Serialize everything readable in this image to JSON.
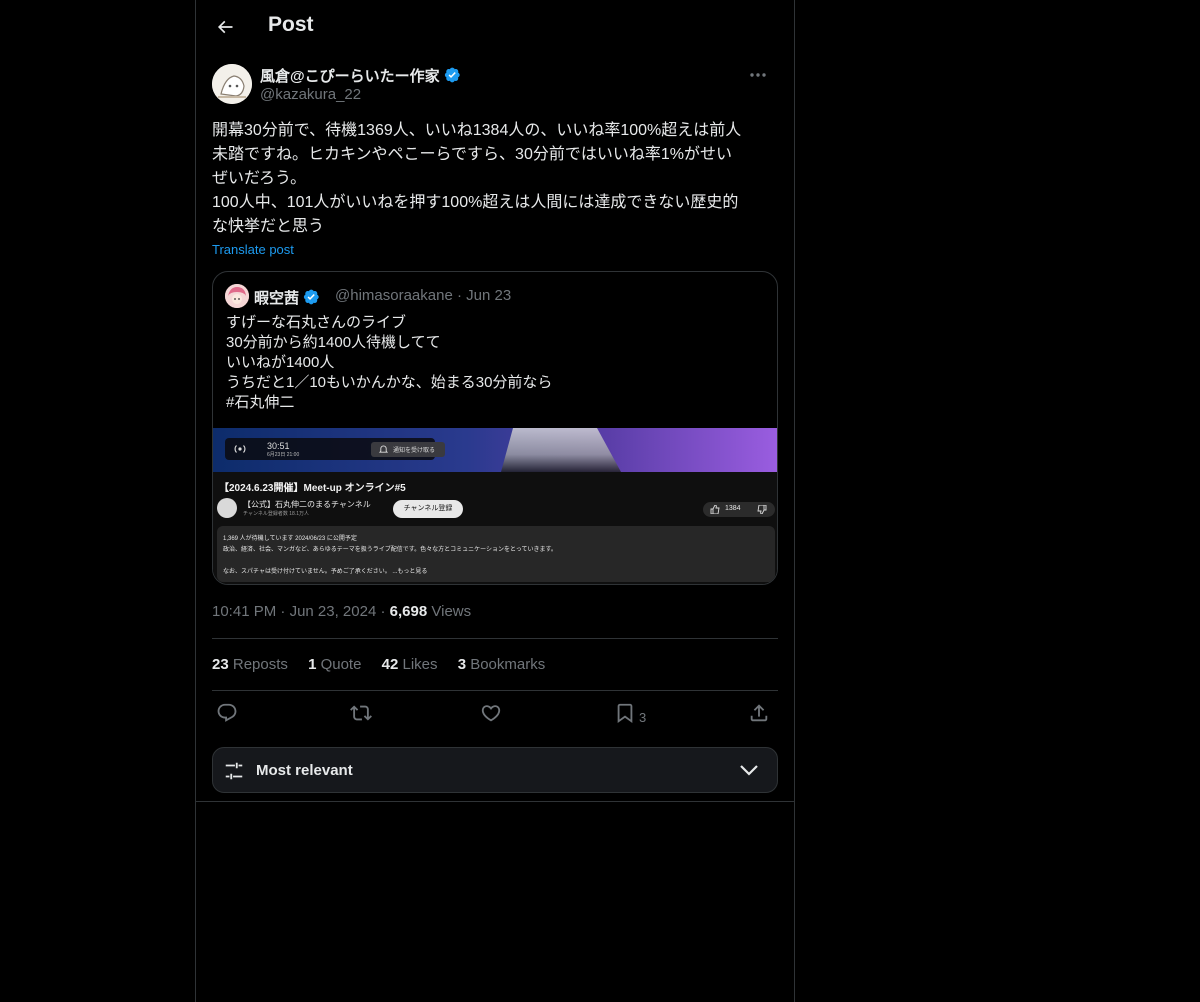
{
  "header": {
    "title": "Post"
  },
  "post": {
    "author_name": "風倉@こぴーらいたー作家",
    "author_handle": "@kazakura_22",
    "text": "開幕30分前で、待機1369人、いいね1384人の、いいね率100%超えは前人\n未踏ですね。ヒカキンやペこーらですら、30分前ではいいね率1%がせい\nぜいだろう。\n100人中、101人がいいねを押す100%超えは人間には達成できない歴史的\nな快挙だと思う",
    "translate_label": "Translate post",
    "time": "10:41 PM",
    "date": "Jun 23, 2024",
    "views_count": "6,698",
    "views_label": "Views"
  },
  "quote": {
    "name": "暇空茜",
    "handle": "@himasoraakane",
    "date": "Jun 23",
    "text": "すげーな石丸さんのライブ\n30分前から約1400人待機してて\nいいねが1400人\nうちだと1／10もいかんかな、始まる30分前なら\n#石丸伸二",
    "media": {
      "time": "30:51",
      "date": "6月23日 21:00",
      "notify_label": "通知を受け取る",
      "title": "【2024.6.23開催】Meet-up オンライン#5",
      "channel": "【公式】石丸伸二のまるチャンネル",
      "subscribers": "チャンネル登録者数 18.1万人",
      "subscribe_label": "チャンネル登録",
      "like_count": "1384",
      "desc_line1": "1,369 人が待機しています 2024/06/23 に公開予定",
      "desc_line2": "政治、経済、社会、マンガなど、あらゆるテーマを扱うライブ配信です。色々な方とコミュニケーションをとっていきます。",
      "desc_line3": "なお、スパチャは受け付けていません。予めご了承ください。 ...もっと見る"
    }
  },
  "stats": {
    "reposts_count": "23",
    "reposts_label": "Reposts",
    "quotes_count": "1",
    "quotes_label": "Quote",
    "likes_count": "42",
    "likes_label": "Likes",
    "bookmarks_count": "3",
    "bookmarks_label": "Bookmarks"
  },
  "actions": {
    "bookmark_count": "3"
  },
  "sort": {
    "label": "Most relevant"
  },
  "colors": {
    "background": "#000000",
    "accent": "#1d9bf0",
    "text": "#e7e9ea",
    "muted": "#71767b",
    "border": "#2f3336"
  }
}
